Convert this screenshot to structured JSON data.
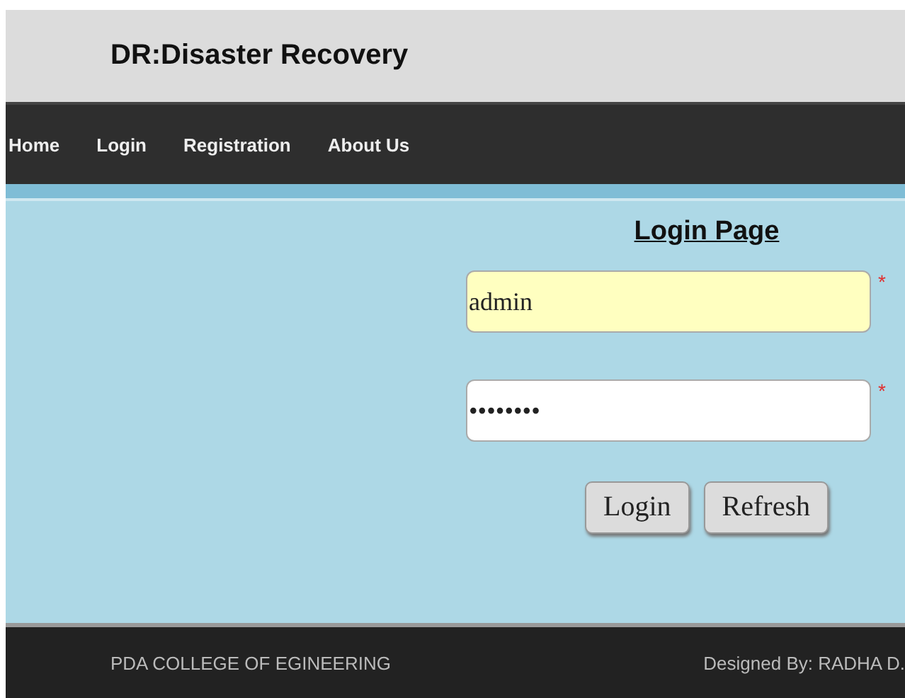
{
  "header": {
    "title": "DR:Disaster Recovery"
  },
  "nav": {
    "items": [
      {
        "label": "Home"
      },
      {
        "label": "Login"
      },
      {
        "label": "Registration"
      },
      {
        "label": "About Us"
      }
    ]
  },
  "login_form": {
    "heading": "Login Page",
    "fields": [
      {
        "kind": "username",
        "value": "admin",
        "required_mark": "*"
      },
      {
        "kind": "password",
        "value": "••••••••",
        "required_mark": "*"
      }
    ],
    "buttons": [
      "Login",
      "Refresh"
    ]
  },
  "footer": {
    "left": "PDA COLLEGE OF EGINEERING",
    "right": "Designed By: RADHA D."
  }
}
